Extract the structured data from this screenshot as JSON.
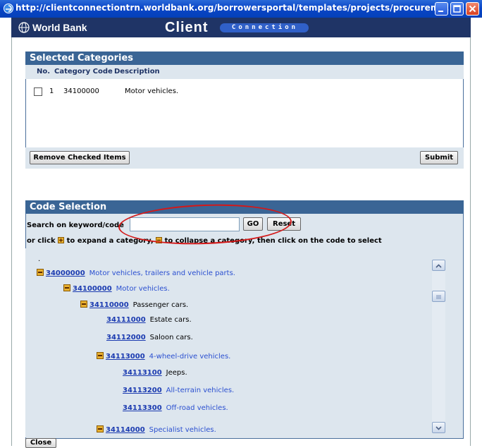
{
  "window": {
    "title": "http://clientconnectiontrn.worldbank.org/borrowersportal/templates/projects/procurem...",
    "controls": [
      "minimize",
      "maximize",
      "close"
    ]
  },
  "brand": {
    "org": "World Bank",
    "app": "Client",
    "app_sub": "Connection"
  },
  "selected": {
    "title": "Selected Categories",
    "columns": [
      "No.",
      "Category Code",
      "Description"
    ],
    "rows": [
      {
        "no": "1",
        "code": "34100000",
        "desc": "Motor vehicles."
      }
    ],
    "remove_label": "Remove Checked Items",
    "submit_label": "Submit"
  },
  "code_selection": {
    "title": "Code Selection",
    "search_label": "Search on keyword/code",
    "search_value": "",
    "go_label": "GO",
    "reset_label": "Reset",
    "instr_a": "or click ",
    "instr_b": " to expand a category, ",
    "instr_c": " to collapse a category, then click on the code to select",
    "dot": ".",
    "tree": [
      {
        "code": "34000000",
        "desc": "Motor vehicles, trailers and vehicle parts.",
        "toggle": true
      },
      {
        "code": "34100000",
        "desc": "Motor vehicles.",
        "toggle": true
      },
      {
        "code": "34110000",
        "desc": "Passenger cars.",
        "toggle": true
      },
      {
        "code": "34111000",
        "desc": "Estate cars.",
        "toggle": false
      },
      {
        "code": "34112000",
        "desc": "Saloon cars.",
        "toggle": false
      },
      {
        "code": "34113000",
        "desc": "4-wheel-drive vehicles.",
        "toggle": true
      },
      {
        "code": "34113100",
        "desc": "Jeeps.",
        "toggle": false
      },
      {
        "code": "34113200",
        "desc": "All-terrain vehicles.",
        "toggle": false
      },
      {
        "code": "34113300",
        "desc": "Off-road vehicles.",
        "toggle": false
      },
      {
        "code": "34114000",
        "desc": "Specialist vehicles.",
        "toggle": true
      }
    ]
  },
  "close_label": "Close",
  "colors": {
    "title_bar": "#0a46c8",
    "brand_bar": "#1f3466",
    "panel_header": "#3a6595",
    "panel_bg": "#dde6ee",
    "link": "#1a3ab0",
    "annotation": "#d41818"
  }
}
